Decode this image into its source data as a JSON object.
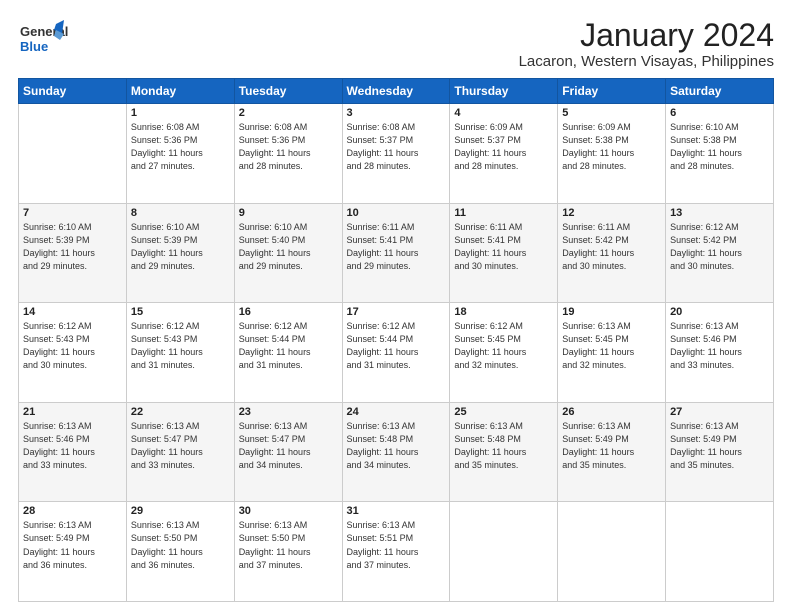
{
  "logo": {
    "general": "General",
    "blue": "Blue"
  },
  "title": "January 2024",
  "location": "Lacaron, Western Visayas, Philippines",
  "weekdays": [
    "Sunday",
    "Monday",
    "Tuesday",
    "Wednesday",
    "Thursday",
    "Friday",
    "Saturday"
  ],
  "weeks": [
    [
      {
        "day": "",
        "sunrise": "",
        "sunset": "",
        "daylight": ""
      },
      {
        "day": "1",
        "sunrise": "Sunrise: 6:08 AM",
        "sunset": "Sunset: 5:36 PM",
        "daylight": "Daylight: 11 hours and 27 minutes."
      },
      {
        "day": "2",
        "sunrise": "Sunrise: 6:08 AM",
        "sunset": "Sunset: 5:36 PM",
        "daylight": "Daylight: 11 hours and 28 minutes."
      },
      {
        "day": "3",
        "sunrise": "Sunrise: 6:08 AM",
        "sunset": "Sunset: 5:37 PM",
        "daylight": "Daylight: 11 hours and 28 minutes."
      },
      {
        "day": "4",
        "sunrise": "Sunrise: 6:09 AM",
        "sunset": "Sunset: 5:37 PM",
        "daylight": "Daylight: 11 hours and 28 minutes."
      },
      {
        "day": "5",
        "sunrise": "Sunrise: 6:09 AM",
        "sunset": "Sunset: 5:38 PM",
        "daylight": "Daylight: 11 hours and 28 minutes."
      },
      {
        "day": "6",
        "sunrise": "Sunrise: 6:10 AM",
        "sunset": "Sunset: 5:38 PM",
        "daylight": "Daylight: 11 hours and 28 minutes."
      }
    ],
    [
      {
        "day": "7",
        "sunrise": "Sunrise: 6:10 AM",
        "sunset": "Sunset: 5:39 PM",
        "daylight": "Daylight: 11 hours and 29 minutes."
      },
      {
        "day": "8",
        "sunrise": "Sunrise: 6:10 AM",
        "sunset": "Sunset: 5:39 PM",
        "daylight": "Daylight: 11 hours and 29 minutes."
      },
      {
        "day": "9",
        "sunrise": "Sunrise: 6:10 AM",
        "sunset": "Sunset: 5:40 PM",
        "daylight": "Daylight: 11 hours and 29 minutes."
      },
      {
        "day": "10",
        "sunrise": "Sunrise: 6:11 AM",
        "sunset": "Sunset: 5:41 PM",
        "daylight": "Daylight: 11 hours and 29 minutes."
      },
      {
        "day": "11",
        "sunrise": "Sunrise: 6:11 AM",
        "sunset": "Sunset: 5:41 PM",
        "daylight": "Daylight: 11 hours and 30 minutes."
      },
      {
        "day": "12",
        "sunrise": "Sunrise: 6:11 AM",
        "sunset": "Sunset: 5:42 PM",
        "daylight": "Daylight: 11 hours and 30 minutes."
      },
      {
        "day": "13",
        "sunrise": "Sunrise: 6:12 AM",
        "sunset": "Sunset: 5:42 PM",
        "daylight": "Daylight: 11 hours and 30 minutes."
      }
    ],
    [
      {
        "day": "14",
        "sunrise": "Sunrise: 6:12 AM",
        "sunset": "Sunset: 5:43 PM",
        "daylight": "Daylight: 11 hours and 30 minutes."
      },
      {
        "day": "15",
        "sunrise": "Sunrise: 6:12 AM",
        "sunset": "Sunset: 5:43 PM",
        "daylight": "Daylight: 11 hours and 31 minutes."
      },
      {
        "day": "16",
        "sunrise": "Sunrise: 6:12 AM",
        "sunset": "Sunset: 5:44 PM",
        "daylight": "Daylight: 11 hours and 31 minutes."
      },
      {
        "day": "17",
        "sunrise": "Sunrise: 6:12 AM",
        "sunset": "Sunset: 5:44 PM",
        "daylight": "Daylight: 11 hours and 31 minutes."
      },
      {
        "day": "18",
        "sunrise": "Sunrise: 6:12 AM",
        "sunset": "Sunset: 5:45 PM",
        "daylight": "Daylight: 11 hours and 32 minutes."
      },
      {
        "day": "19",
        "sunrise": "Sunrise: 6:13 AM",
        "sunset": "Sunset: 5:45 PM",
        "daylight": "Daylight: 11 hours and 32 minutes."
      },
      {
        "day": "20",
        "sunrise": "Sunrise: 6:13 AM",
        "sunset": "Sunset: 5:46 PM",
        "daylight": "Daylight: 11 hours and 33 minutes."
      }
    ],
    [
      {
        "day": "21",
        "sunrise": "Sunrise: 6:13 AM",
        "sunset": "Sunset: 5:46 PM",
        "daylight": "Daylight: 11 hours and 33 minutes."
      },
      {
        "day": "22",
        "sunrise": "Sunrise: 6:13 AM",
        "sunset": "Sunset: 5:47 PM",
        "daylight": "Daylight: 11 hours and 33 minutes."
      },
      {
        "day": "23",
        "sunrise": "Sunrise: 6:13 AM",
        "sunset": "Sunset: 5:47 PM",
        "daylight": "Daylight: 11 hours and 34 minutes."
      },
      {
        "day": "24",
        "sunrise": "Sunrise: 6:13 AM",
        "sunset": "Sunset: 5:48 PM",
        "daylight": "Daylight: 11 hours and 34 minutes."
      },
      {
        "day": "25",
        "sunrise": "Sunrise: 6:13 AM",
        "sunset": "Sunset: 5:48 PM",
        "daylight": "Daylight: 11 hours and 35 minutes."
      },
      {
        "day": "26",
        "sunrise": "Sunrise: 6:13 AM",
        "sunset": "Sunset: 5:49 PM",
        "daylight": "Daylight: 11 hours and 35 minutes."
      },
      {
        "day": "27",
        "sunrise": "Sunrise: 6:13 AM",
        "sunset": "Sunset: 5:49 PM",
        "daylight": "Daylight: 11 hours and 35 minutes."
      }
    ],
    [
      {
        "day": "28",
        "sunrise": "Sunrise: 6:13 AM",
        "sunset": "Sunset: 5:49 PM",
        "daylight": "Daylight: 11 hours and 36 minutes."
      },
      {
        "day": "29",
        "sunrise": "Sunrise: 6:13 AM",
        "sunset": "Sunset: 5:50 PM",
        "daylight": "Daylight: 11 hours and 36 minutes."
      },
      {
        "day": "30",
        "sunrise": "Sunrise: 6:13 AM",
        "sunset": "Sunset: 5:50 PM",
        "daylight": "Daylight: 11 hours and 37 minutes."
      },
      {
        "day": "31",
        "sunrise": "Sunrise: 6:13 AM",
        "sunset": "Sunset: 5:51 PM",
        "daylight": "Daylight: 11 hours and 37 minutes."
      },
      {
        "day": "",
        "sunrise": "",
        "sunset": "",
        "daylight": ""
      },
      {
        "day": "",
        "sunrise": "",
        "sunset": "",
        "daylight": ""
      },
      {
        "day": "",
        "sunrise": "",
        "sunset": "",
        "daylight": ""
      }
    ]
  ]
}
